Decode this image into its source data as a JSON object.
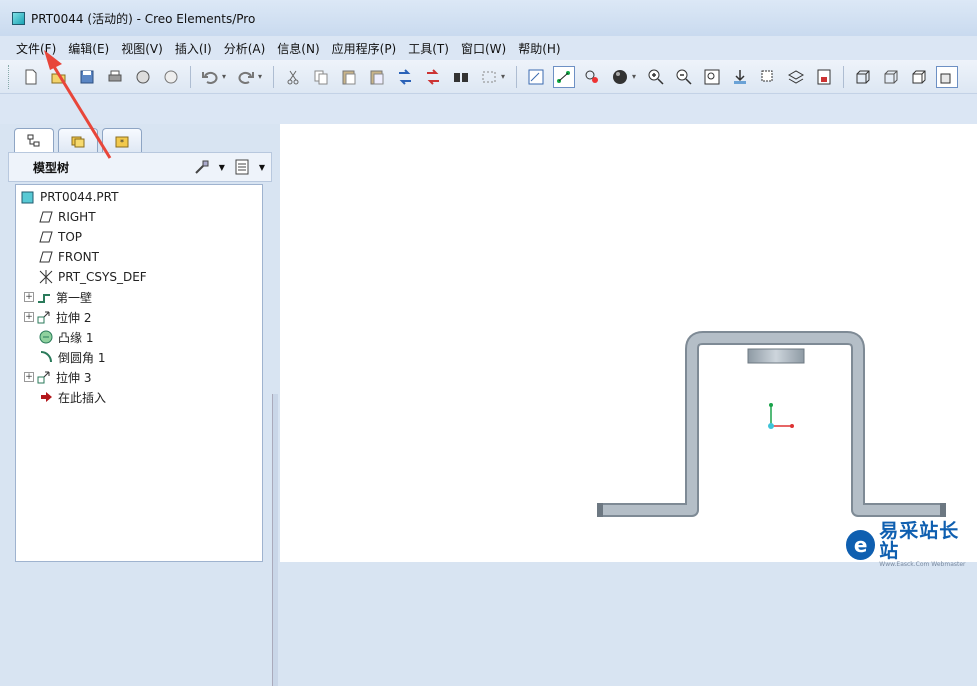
{
  "window": {
    "title": "PRT0044 (活动的) - Creo Elements/Pro"
  },
  "menu": [
    {
      "label": "文件(F)"
    },
    {
      "label": "编辑(E)"
    },
    {
      "label": "视图(V)"
    },
    {
      "label": "插入(I)"
    },
    {
      "label": "分析(A)"
    },
    {
      "label": "信息(N)"
    },
    {
      "label": "应用程序(P)"
    },
    {
      "label": "工具(T)"
    },
    {
      "label": "窗口(W)"
    },
    {
      "label": "帮助(H)"
    }
  ],
  "toolbar": {
    "icons": [
      "new-icon",
      "open-icon",
      "save-icon",
      "print-icon",
      "send-mail-icon",
      "send-mail-attach-icon",
      "undo-icon",
      "redo-icon",
      "cut-icon",
      "copy-icon",
      "paste-icon",
      "paste-special-icon",
      "regenerate-icon",
      "regenerate-manager-icon",
      "find-icon",
      "select-box-icon",
      "view-manager-icon",
      "datum-display-icon",
      "appearance-icon",
      "sphere-icon",
      "zoom-in-icon",
      "zoom-out-icon",
      "refit-icon",
      "reorient-icon",
      "saved-views-icon",
      "layers-icon",
      "model-display-icon",
      "wireframe-icon",
      "hidden-line-icon",
      "no-hidden-icon",
      "shading-icon"
    ]
  },
  "model_tree": {
    "header": "模型树",
    "items": [
      {
        "label": "PRT0044.PRT",
        "icon": "part-icon",
        "expandable": false,
        "root": true
      },
      {
        "label": "RIGHT",
        "icon": "datum-plane-icon",
        "expandable": false
      },
      {
        "label": "TOP",
        "icon": "datum-plane-icon",
        "expandable": false
      },
      {
        "label": "FRONT",
        "icon": "datum-plane-icon",
        "expandable": false
      },
      {
        "label": "PRT_CSYS_DEF",
        "icon": "csys-icon",
        "expandable": false
      },
      {
        "label": "第一壁",
        "icon": "sheetmetal-wall-icon",
        "expandable": true
      },
      {
        "label": "拉伸 2",
        "icon": "extrude-icon",
        "expandable": true
      },
      {
        "label": "凸缘 1",
        "icon": "flange-icon",
        "expandable": false
      },
      {
        "label": "倒圆角 1",
        "icon": "round-icon",
        "expandable": false
      },
      {
        "label": "拉伸 3",
        "icon": "extrude-icon",
        "expandable": true
      },
      {
        "label": "在此插入",
        "icon": "insert-here-icon",
        "expandable": false
      }
    ]
  },
  "colors": {
    "accent": "#0f5fb0",
    "part_gray": "#a7b1ba",
    "annotation_arrow": "#e8463a"
  },
  "watermark": {
    "text": "易采站长站",
    "subtext": "Www.Easck.Com Webmaster"
  }
}
